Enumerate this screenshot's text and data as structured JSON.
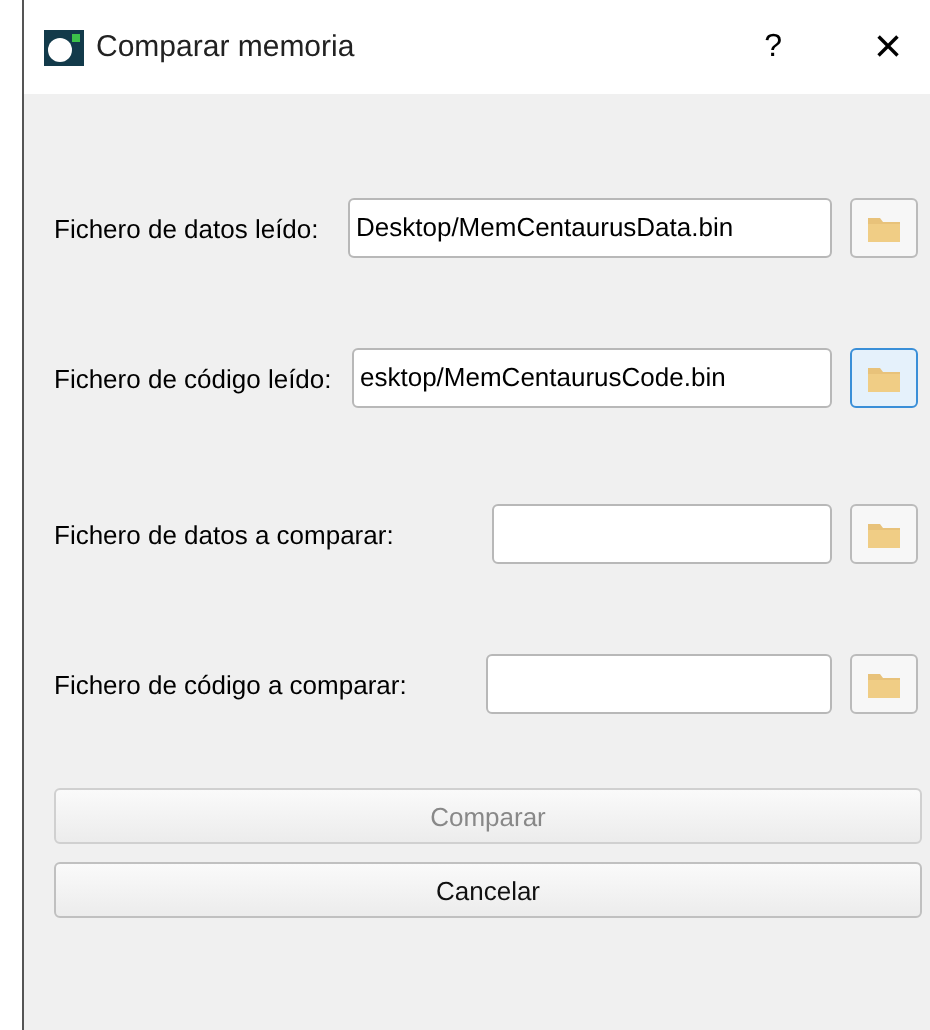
{
  "window": {
    "title": "Comparar memoria",
    "help": "?",
    "close": "×"
  },
  "rows": [
    {
      "label": "Fichero de datos leído:",
      "value": "Desktop/MemCentaurusData.bin",
      "focused": false
    },
    {
      "label": "Fichero de código leído:",
      "value": "esktop/MemCentaurusCode.bin",
      "focused": true
    },
    {
      "label": "Fichero de datos a comparar:",
      "value": "",
      "focused": false
    },
    {
      "label": "Fichero de código a comparar:",
      "value": "",
      "focused": false
    }
  ],
  "buttons": [
    {
      "label": "Comparar",
      "disabled": true
    },
    {
      "label": "Cancelar",
      "disabled": false
    }
  ]
}
